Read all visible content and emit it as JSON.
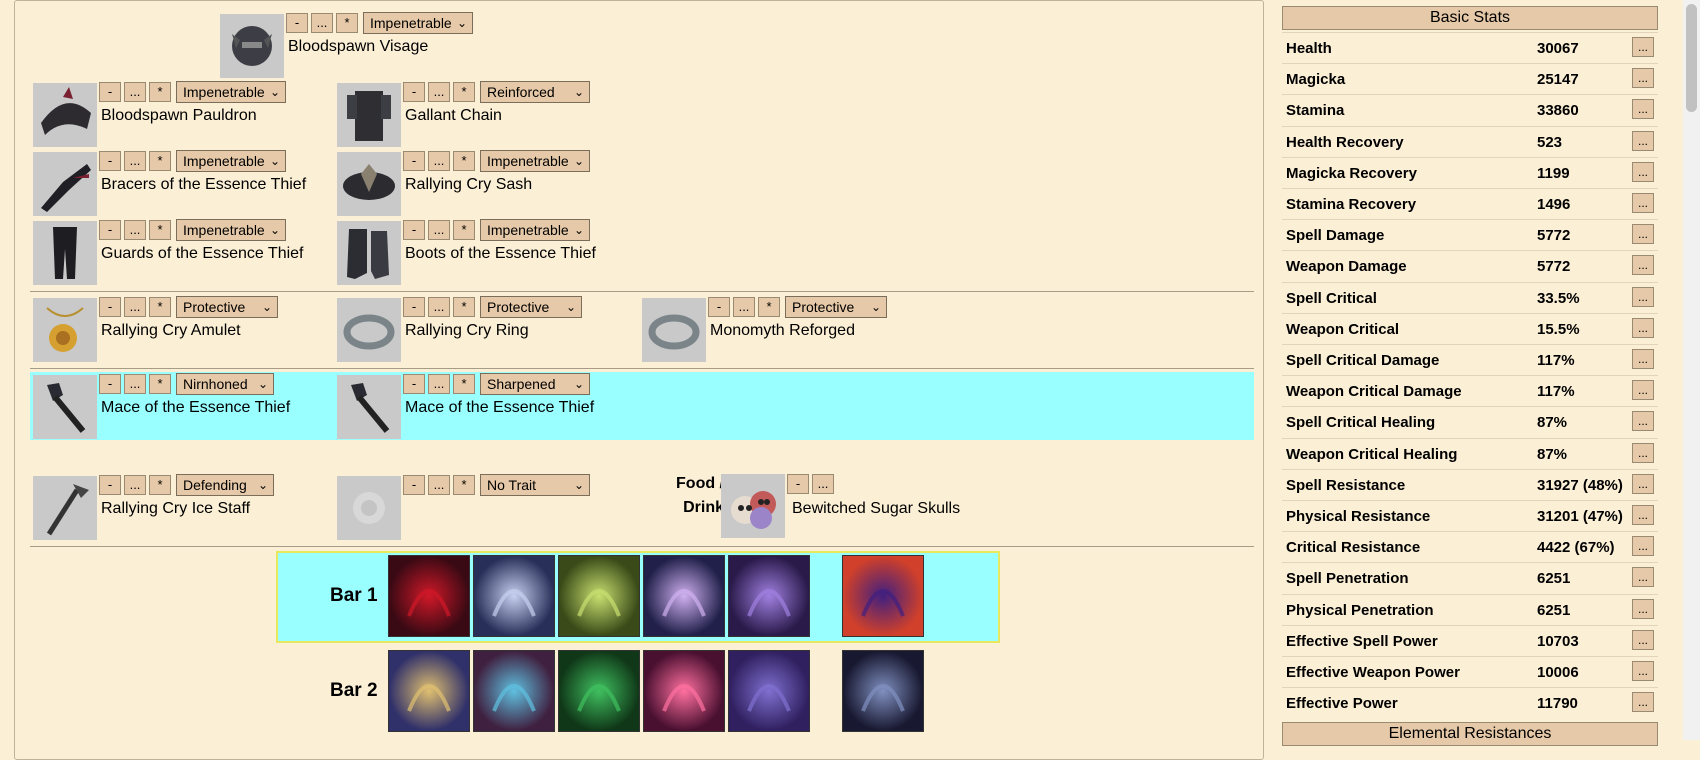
{
  "controls": {
    "minus": "-",
    "ellipsis": "...",
    "star": "*",
    "chevron": "⌄"
  },
  "gear": {
    "head": {
      "name": "Bloodspawn Visage",
      "trait": "Impenetrable",
      "icon": "helmet-icon"
    },
    "shoulders": {
      "name": "Bloodspawn Pauldron",
      "trait": "Impenetrable",
      "icon": "pauldron-icon"
    },
    "chest": {
      "name": "Gallant Chain",
      "trait": "Reinforced",
      "icon": "chest-armor-icon"
    },
    "hands": {
      "name": "Bracers of the Essence Thief",
      "trait": "Impenetrable",
      "icon": "gloves-icon"
    },
    "waist": {
      "name": "Rallying Cry Sash",
      "trait": "Impenetrable",
      "icon": "belt-icon"
    },
    "legs": {
      "name": "Guards of the Essence Thief",
      "trait": "Impenetrable",
      "icon": "legs-icon"
    },
    "feet": {
      "name": "Boots of the Essence Thief",
      "trait": "Impenetrable",
      "icon": "boots-icon"
    },
    "neck": {
      "name": "Rallying Cry Amulet",
      "trait": "Protective",
      "icon": "amulet-icon"
    },
    "ring1": {
      "name": "Rallying Cry Ring",
      "trait": "Protective",
      "icon": "ring-icon"
    },
    "ring2": {
      "name": "Monomyth Reforged",
      "trait": "Protective",
      "icon": "ring-icon"
    },
    "mainhand1": {
      "name": "Mace of the Essence Thief",
      "trait": "Nirnhoned",
      "icon": "mace-icon"
    },
    "offhand1": {
      "name": "Mace of the Essence Thief",
      "trait": "Sharpened",
      "icon": "mace-icon"
    },
    "mainhand2": {
      "name": "Rallying Cry Ice Staff",
      "trait": "Defending",
      "icon": "staff-icon"
    },
    "offhand2": {
      "name": "",
      "trait": "No Trait",
      "icon": "empty-slot-icon"
    }
  },
  "food": {
    "label": "Food / Drink",
    "name": "Bewitched Sugar Skulls",
    "icon": "sugar-skulls-icon"
  },
  "bars": [
    {
      "label": "Bar 1",
      "skills": [
        "claw-skill-icon",
        "wings-skill-icon",
        "blades-skill-icon",
        "mage-skill-icon",
        "vortex-skill-icon"
      ],
      "ultimate": "ultimate-warrior-icon"
    },
    {
      "label": "Bar 2",
      "skills": [
        "wizard-skill-icon",
        "orb-skill-icon",
        "druid-skill-icon",
        "comet-skill-icon",
        "spiral-skill-icon"
      ],
      "ultimate": "shadow-ultimate-icon"
    }
  ],
  "colors": {
    "background": "#fbefd6",
    "highlight": "#99ffff",
    "button": "#e6c9a8",
    "bar_border": "#e8e860"
  },
  "stats": {
    "header": "Basic Stats",
    "rows": [
      {
        "name": "Health",
        "value": "30067"
      },
      {
        "name": "Magicka",
        "value": "25147"
      },
      {
        "name": "Stamina",
        "value": "33860"
      },
      {
        "name": "Health Recovery",
        "value": "523"
      },
      {
        "name": "Magicka Recovery",
        "value": "1199"
      },
      {
        "name": "Stamina Recovery",
        "value": "1496"
      },
      {
        "name": "Spell Damage",
        "value": "5772"
      },
      {
        "name": "Weapon Damage",
        "value": "5772"
      },
      {
        "name": "Spell Critical",
        "value": "33.5%"
      },
      {
        "name": "Weapon Critical",
        "value": "15.5%"
      },
      {
        "name": "Spell Critical Damage",
        "value": "117%"
      },
      {
        "name": "Weapon Critical Damage",
        "value": "117%"
      },
      {
        "name": "Spell Critical Healing",
        "value": "87%"
      },
      {
        "name": "Weapon Critical Healing",
        "value": "87%"
      },
      {
        "name": "Spell Resistance",
        "value": "31927 (48%)"
      },
      {
        "name": "Physical Resistance",
        "value": "31201 (47%)"
      },
      {
        "name": "Critical Resistance",
        "value": "4422 (67%)"
      },
      {
        "name": "Spell Penetration",
        "value": "6251"
      },
      {
        "name": "Physical Penetration",
        "value": "6251"
      },
      {
        "name": "Effective Spell Power",
        "value": "10703"
      },
      {
        "name": "Effective Weapon Power",
        "value": "10006"
      },
      {
        "name": "Effective Power",
        "value": "11790"
      }
    ],
    "next_header": "Elemental Resistances"
  }
}
